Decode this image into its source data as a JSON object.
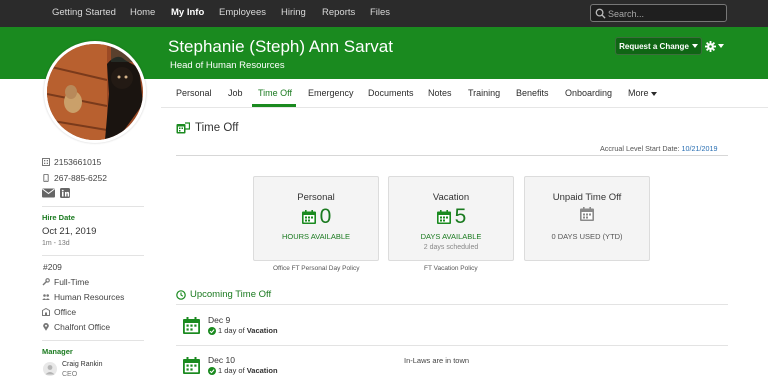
{
  "topnav": {
    "items": [
      "Getting Started",
      "Home",
      "My Info",
      "Employees",
      "Hiring",
      "Reports",
      "Files"
    ],
    "active": "My Info",
    "search_placeholder": "Search..."
  },
  "header": {
    "name": "Stephanie (Steph) Ann Sarvat",
    "title": "Head of Human Resources",
    "request_change_label": "Request a Change"
  },
  "tabs": {
    "items": [
      "Personal",
      "Job",
      "Time Off",
      "Emergency",
      "Documents",
      "Notes",
      "Training",
      "Benefits",
      "Onboarding",
      "More"
    ],
    "active": "Time Off"
  },
  "sidebar": {
    "work_phone": "2153661015",
    "mobile_phone": "267-885-6252",
    "hire_date_label": "Hire Date",
    "hire_date": "Oct 21, 2019",
    "tenure": "1m - 13d",
    "employee_number": "#209",
    "employment_type": "Full-Time",
    "department": "Human Resources",
    "location_type": "Office",
    "office": "Chalfont Office",
    "manager_label": "Manager",
    "manager_name": "Craig Rankin",
    "manager_title": "CEO"
  },
  "timeoff": {
    "section_title": "Time Off",
    "accrual_label": "Accrual Level Start Date:",
    "accrual_date": "10/21/2019",
    "cards": [
      {
        "title": "Personal",
        "value": "0",
        "unit": "HOURS AVAILABLE",
        "sub": "",
        "policy": "Office FT Personal Day Policy"
      },
      {
        "title": "Vacation",
        "value": "5",
        "unit": "DAYS AVAILABLE",
        "sub": "2 days scheduled",
        "policy": "FT Vacation Policy"
      },
      {
        "title": "Unpaid Time Off",
        "value": "",
        "unit": "0 DAYS USED (YTD)",
        "sub": "",
        "policy": ""
      }
    ]
  },
  "upcoming": {
    "title": "Upcoming Time Off",
    "events": [
      {
        "date": "Dec 9",
        "amount": "1 day of",
        "type": "Vacation",
        "note": ""
      },
      {
        "date": "Dec 10",
        "amount": "1 day of",
        "type": "Vacation",
        "note": "In-Laws are in town"
      }
    ]
  },
  "colors": {
    "brand_green": "#1a8a1f",
    "topbar": "#2b2b2b",
    "link_blue": "#2a6fb3"
  }
}
